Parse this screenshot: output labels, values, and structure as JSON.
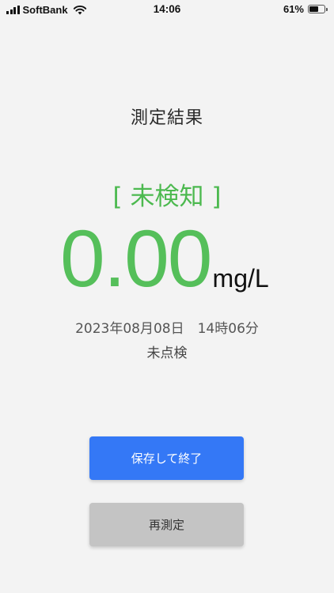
{
  "status_bar": {
    "carrier": "SoftBank",
    "time": "14:06",
    "battery_percent": "61%",
    "battery_level": 0.61,
    "signal_icon": "signal-bars-icon",
    "wifi_icon": "wifi-icon",
    "battery_icon": "battery-icon"
  },
  "heading": "測定結果",
  "result": {
    "status_label": "[ 未検知 ]",
    "value": "0.00",
    "unit": "mg/L",
    "datetime": "2023年08月08日　14時06分",
    "inspection_status": "未点検"
  },
  "buttons": {
    "save_label": "保存して終了",
    "remeasure_label": "再測定"
  },
  "colors": {
    "accent_green": "#55bf5a",
    "primary_blue": "#3478f6",
    "secondary_gray": "#c4c4c4",
    "background": "#f3f3f3"
  }
}
